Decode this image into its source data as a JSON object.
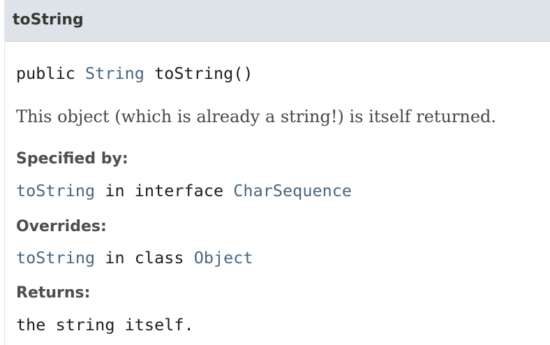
{
  "header": {
    "title": "toString"
  },
  "signature": {
    "modifier": "public",
    "return_type": "String",
    "method": "toString()"
  },
  "description": "This object (which is already a string!) is itself returned.",
  "specified_by": {
    "label": "Specified by:",
    "method": "toString",
    "connector": "in interface",
    "type": "CharSequence"
  },
  "overrides": {
    "label": "Overrides:",
    "method": "toString",
    "connector": "in class",
    "type": "Object"
  },
  "returns": {
    "label": "Returns:",
    "text": "the string itself."
  },
  "colors": {
    "header_bg": "#dee3e9",
    "link": "#4a6782",
    "text": "#1e1e1e"
  }
}
